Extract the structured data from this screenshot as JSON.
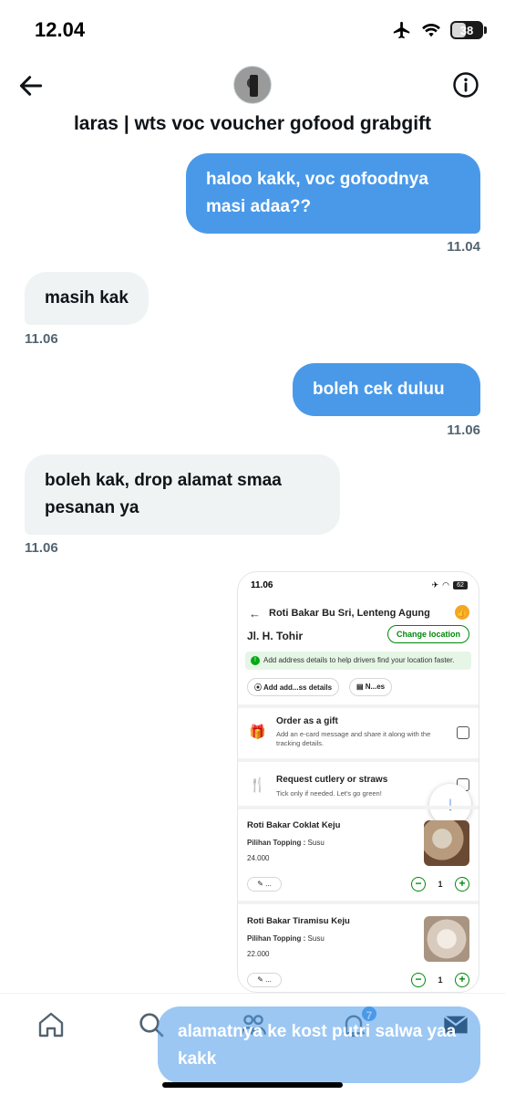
{
  "status_bar": {
    "time": "12.04",
    "battery": "38"
  },
  "header": {
    "contact_name": "laras | wts voc voucher gofood grabgift"
  },
  "messages": [
    {
      "from": "me",
      "text": "haloo kakk, voc gofoodnya masi adaa??",
      "time": "11.04"
    },
    {
      "from": "them",
      "text": "masih kak",
      "time": "11.06"
    },
    {
      "from": "me",
      "text": "boleh cek duluu",
      "time": "11.06"
    },
    {
      "from": "them",
      "text": "boleh kak, drop alamat smaa pesanan ya",
      "time": "11.06"
    }
  ],
  "attachment": {
    "status_time": "11.06",
    "status_battery": "62",
    "title": "Roti Bakar Bu Sri, Lenteng Agung",
    "address": "Jl. H. Tohir",
    "change_location": "Change location",
    "note": "Add address details to help drivers find your location faster.",
    "chips": [
      "Add add...ss details",
      "N...es"
    ],
    "gift": {
      "title": "Order as a gift",
      "subtitle": "Add an e-card message and share it along with the tracking details."
    },
    "cutlery": {
      "title": "Request cutlery or straws",
      "subtitle": "Tick only if needed. Let's go green!"
    },
    "items": [
      {
        "name": "Roti Bakar Coklat Keju",
        "topping_label": "Pilihan Topping :",
        "topping_value": "Susu",
        "price": "24.000",
        "edit": "...",
        "qty": "1"
      },
      {
        "name": "Roti Bakar Tiramisu Keju",
        "topping_label": "Pilihan Topping :",
        "topping_value": "Susu",
        "price": "22.000",
        "edit": "...",
        "qty": "1"
      }
    ]
  },
  "bottom_nav": {
    "notifications_badge": "7"
  },
  "composer": {
    "text": "alamatnya ke kost putri salwa yaa kakk"
  },
  "colors": {
    "outgoing_bubble": "#4a99e9",
    "incoming_bubble": "#eff3f4",
    "timestamp": "#536471",
    "gojek_green": "#00880a"
  }
}
